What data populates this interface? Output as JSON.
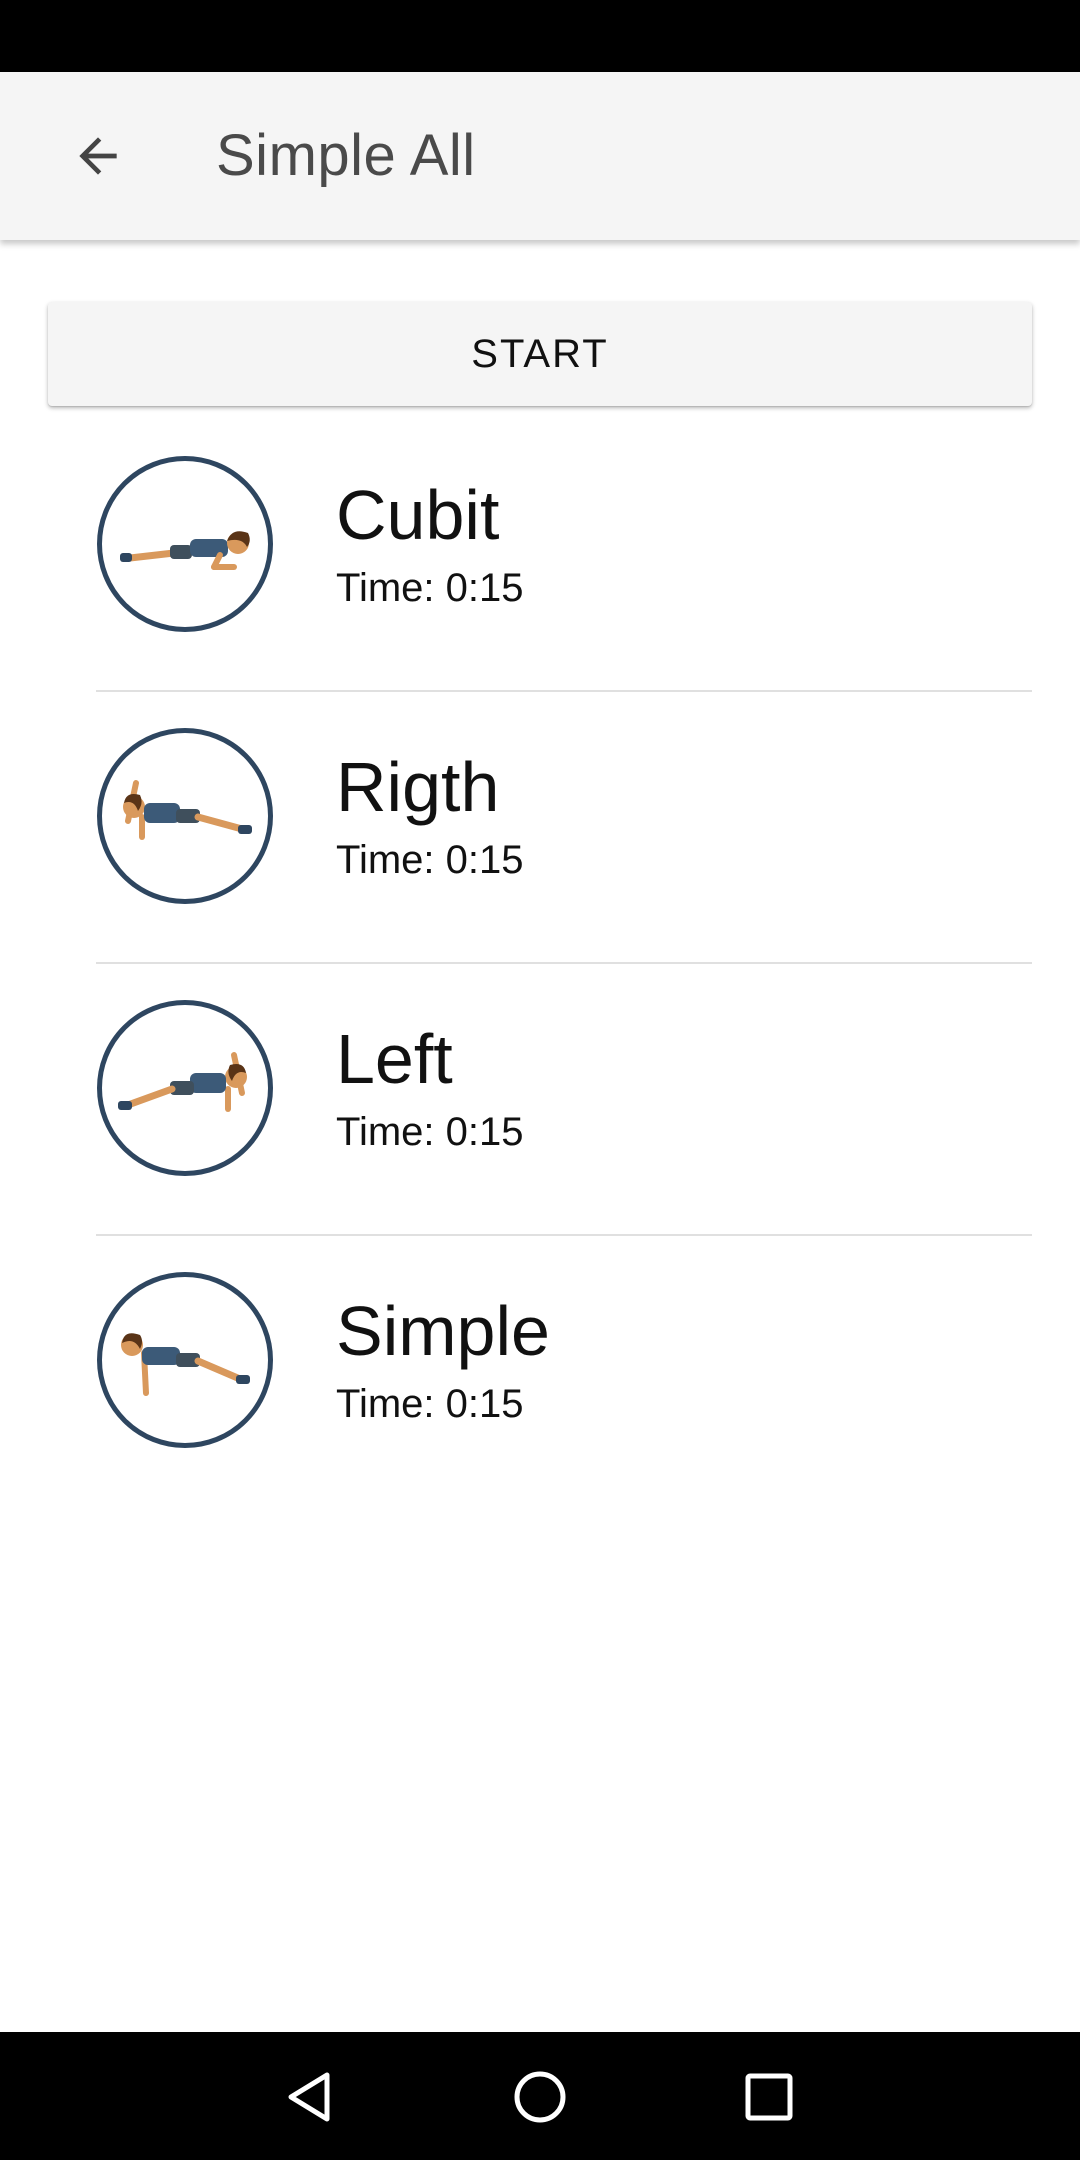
{
  "app_bar": {
    "title": "Simple All",
    "back_icon": "arrow-back-icon"
  },
  "start_button": {
    "label": "START"
  },
  "exercises": [
    {
      "name": "Cubit",
      "time": "Time: 0:15",
      "icon": "plank-elbow-icon"
    },
    {
      "name": "Rigth",
      "time": "Time: 0:15",
      "icon": "side-plank-right-icon"
    },
    {
      "name": "Left",
      "time": "Time: 0:15",
      "icon": "side-plank-left-icon"
    },
    {
      "name": "Simple",
      "time": "Time: 0:15",
      "icon": "plank-straight-arm-icon"
    }
  ],
  "nav_bar": {
    "back_icon": "nav-back-triangle-icon",
    "home_icon": "nav-home-circle-icon",
    "recents_icon": "nav-recents-square-icon"
  },
  "colors": {
    "app_bar_bg": "#f5f5f5",
    "avatar_ring": "#2e4660",
    "divider": "#e0e0e0",
    "system_bars": "#000000"
  }
}
